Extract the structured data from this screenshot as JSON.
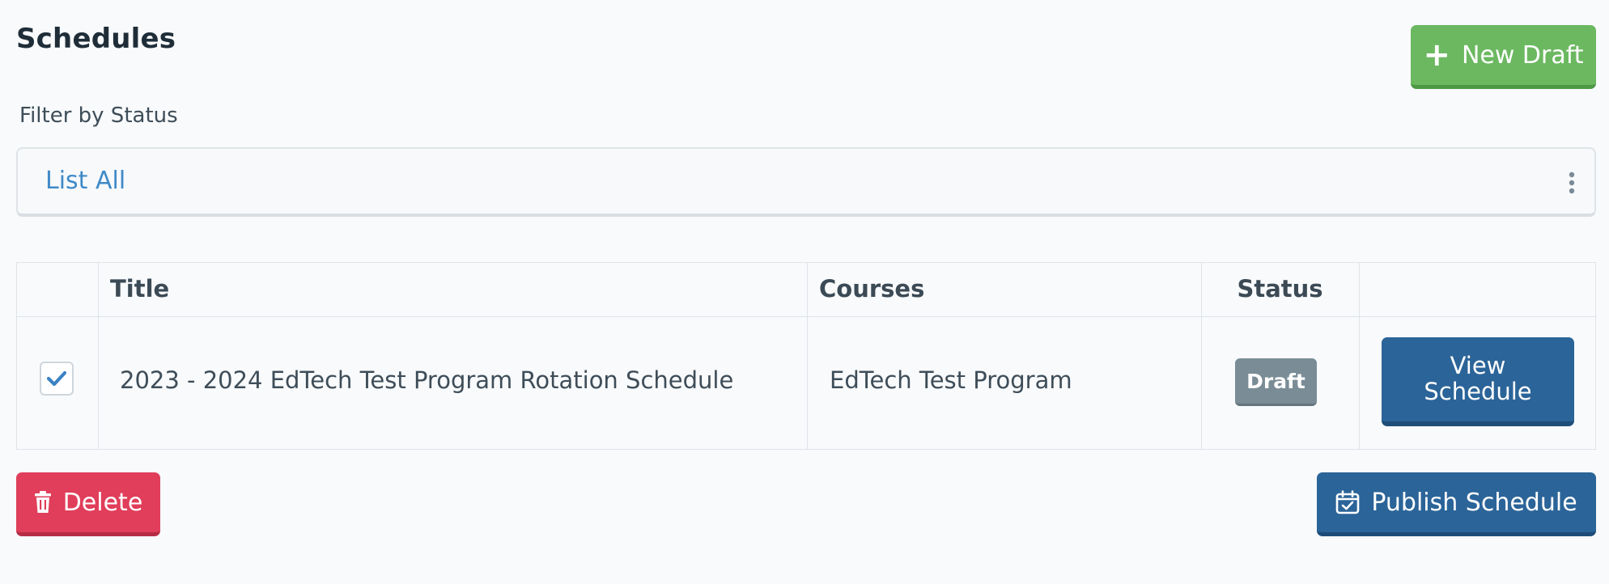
{
  "header": {
    "title": "Schedules",
    "new_draft_label": "New Draft"
  },
  "filter": {
    "label": "Filter by Status",
    "selected": "List All"
  },
  "table": {
    "columns": [
      "",
      "Title",
      "Courses",
      "Status",
      ""
    ],
    "rows": [
      {
        "checked": true,
        "title": "2023 - 2024 EdTech Test Program Rotation Schedule",
        "courses": "EdTech Test Program",
        "status": "Draft",
        "action_label": "View Schedule"
      }
    ]
  },
  "footer": {
    "delete_label": "Delete",
    "publish_label": "Publish Schedule"
  },
  "colors": {
    "primary": "#2b6498",
    "success": "#6cb861",
    "danger": "#e03e5a",
    "badge": "#7a8c96",
    "link": "#3f8ac7"
  },
  "icons": {
    "new_draft": "plus-icon",
    "filter_menu": "kebab-icon",
    "checkbox": "check-icon",
    "delete": "trash-icon",
    "publish": "calendar-check-icon"
  }
}
